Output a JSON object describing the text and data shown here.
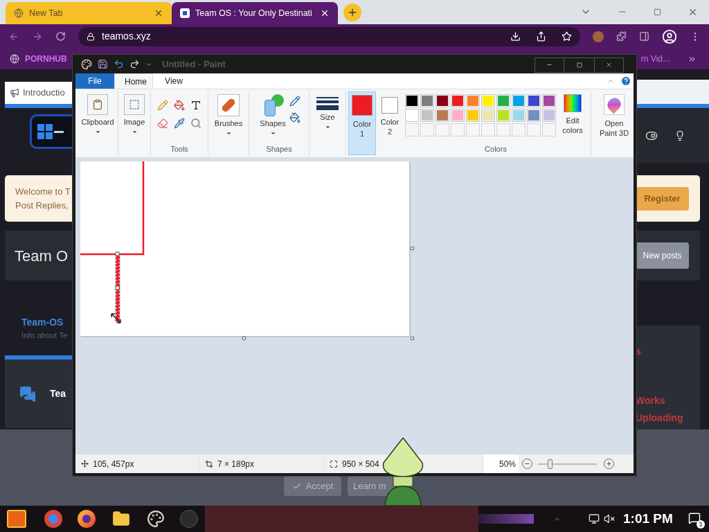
{
  "browser": {
    "tabs": [
      {
        "title": "New Tab",
        "selected": false
      },
      {
        "title": "Team OS : Your Only Destinati",
        "selected": true
      }
    ],
    "address": "teamos.xyz",
    "bookmarks": [
      {
        "label": "PORNHUB"
      },
      {
        "label": "rn Vid…"
      }
    ]
  },
  "site": {
    "intro_tab": "Introductio",
    "welcome_lines": [
      "Welcome to T",
      "Post Replies,"
    ],
    "heading": "Team O",
    "forum_title": "Team-OS",
    "forum_subtitle": "Info about Te",
    "node_title": "Tea",
    "register": "Register",
    "new_posts": "New posts",
    "red_texts": [
      "s",
      "Works",
      "Uploading"
    ],
    "accept": "Accept",
    "learn_more": "Learn m"
  },
  "paint": {
    "title": "Untitled - Paint",
    "tabs": [
      {
        "label": "File",
        "kind": "file",
        "selected": false
      },
      {
        "label": "Home",
        "kind": "tab",
        "selected": true
      },
      {
        "label": "View",
        "kind": "tab",
        "selected": false
      }
    ],
    "clipboard": "Clipboard",
    "image": "Image",
    "tools_label": "Tools",
    "brushes": "Brushes",
    "shapes": "Shapes",
    "shapes_label": "Shapes",
    "size": "Size",
    "color1": {
      "label": "Color 1",
      "color": "#ed1c24",
      "selected": true
    },
    "color2": {
      "label": "Color 2",
      "color": "#ffffff",
      "selected": false
    },
    "palette": [
      {
        "color": "#000000"
      },
      {
        "color": "#7f7f7f"
      },
      {
        "color": "#880015"
      },
      {
        "color": "#ed1c24"
      },
      {
        "color": "#ff7f27"
      },
      {
        "color": "#fff200"
      },
      {
        "color": "#22b14c"
      },
      {
        "color": "#00a2e8"
      },
      {
        "color": "#3f48cc"
      },
      {
        "color": "#a349a4"
      },
      {
        "color": "#ffffff"
      },
      {
        "color": "#c3c3c3"
      },
      {
        "color": "#b97a57"
      },
      {
        "color": "#ffaec9"
      },
      {
        "color": "#ffc90e"
      },
      {
        "color": "#efe4b0"
      },
      {
        "color": "#b5e61d"
      },
      {
        "color": "#99d9ea"
      },
      {
        "color": "#7092be"
      },
      {
        "color": "#c8bfe7"
      }
    ],
    "custom_colors": [
      {
        "filled": false
      },
      {
        "filled": false
      },
      {
        "filled": false
      },
      {
        "filled": false
      },
      {
        "filled": false
      },
      {
        "filled": false
      },
      {
        "filled": false
      },
      {
        "filled": false
      },
      {
        "filled": false
      },
      {
        "filled": false
      }
    ],
    "colors_label": "Colors",
    "edit_colors": "Edit colors",
    "open_3d": "Open Paint 3D",
    "status": {
      "position": "105, 457px",
      "selection": "7 × 189px",
      "size": "950 × 504",
      "zoom": "50%",
      "level": 0.2
    }
  },
  "taskbar": {
    "time": "1:01 PM",
    "notifications": "3"
  }
}
